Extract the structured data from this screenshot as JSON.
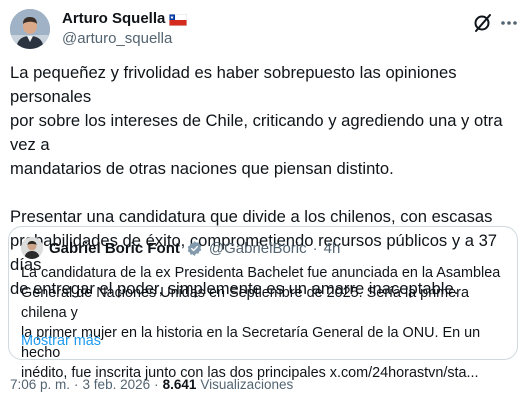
{
  "author": {
    "name": "Arturo Squella",
    "handle": "@arturo_squella"
  },
  "icons": {
    "flag": "chile-flag-icon",
    "grok": "grok-icon",
    "more": "more-icon",
    "verified": "verified-badge-icon"
  },
  "colors": {
    "text": "#0f1419",
    "secondary": "#536471",
    "link": "#1d9bf0",
    "border": "#cfd9de",
    "flag_red": "#d52b1e",
    "flag_blue": "#0039a6"
  },
  "tweet": {
    "text": "La pequeñez y frivolidad es haber sobrepuesto las opiniones personales\npor sobre los intereses de Chile, criticando y agrediendo una y otra vez a\nmandatarios de otras naciones que piensan distinto.\n\nPresentar una candidatura que divide a los chilenos, con escasas\nprobabilidades de éxito, comprometiendo recursos públicos y a 37 días\nde entregar el poder, simplemente es un amarre inaceptable."
  },
  "quote": {
    "name": "Gabriel Boric Font",
    "handle": "@GabrielBoric",
    "separator": "·",
    "time": "4h",
    "text": "La candidatura de la ex Presidenta Bachelet fue anunciada en la Asamblea\nGeneral de Naciones Unidas en Septiembre de 2025. Sería la primera chilena y\nla primer mujer en la historia en la Secretaría General de la ONU. En un hecho\ninédito, fue inscrita junto con las dos principales x.com/24horastvn/sta...",
    "show_more": "Mostrar más"
  },
  "meta": {
    "time": "7:06 p. m.",
    "separator": "·",
    "date": "3 feb. 2026",
    "separator2": "·",
    "views_count": "8.641",
    "views_label": "Visualizaciones"
  }
}
